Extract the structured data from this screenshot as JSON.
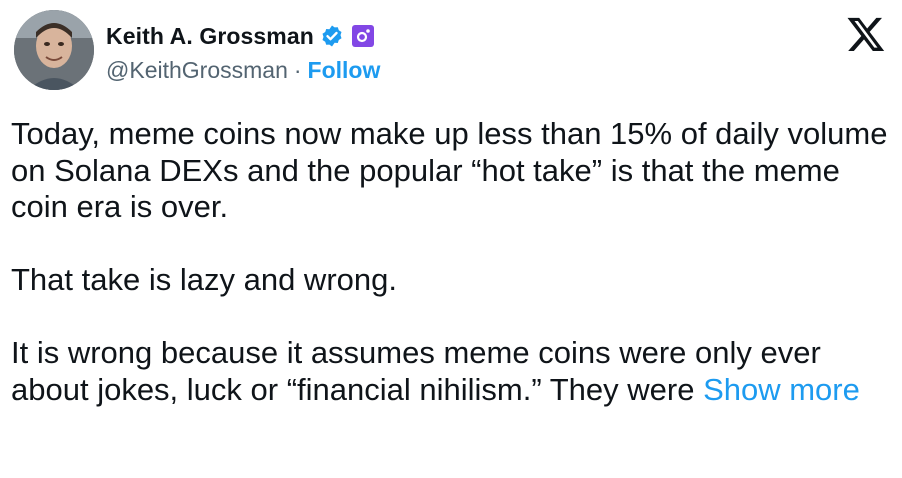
{
  "author": {
    "name": "Keith A. Grossman",
    "handle": "@KeithGrossman",
    "separator": "·",
    "follow_label": "Follow",
    "verified_color": "#1d9bf0",
    "affiliate_badge_color": "#8247e5"
  },
  "icons": {
    "platform": "x-logo",
    "verified": "verified-badge-icon",
    "affiliate": "affiliate-badge-icon"
  },
  "tweet": {
    "paragraphs": [
      "Today, meme coins now make up less than 15% of daily volume on Solana DEXs and the popular “hot take” is that the meme coin era is over.",
      "That take is lazy and wrong."
    ],
    "last_paragraph": "It is wrong because it assumes meme coins were only ever about jokes, luck or “financial nihilism.” They were",
    "show_more_label": "Show more"
  }
}
